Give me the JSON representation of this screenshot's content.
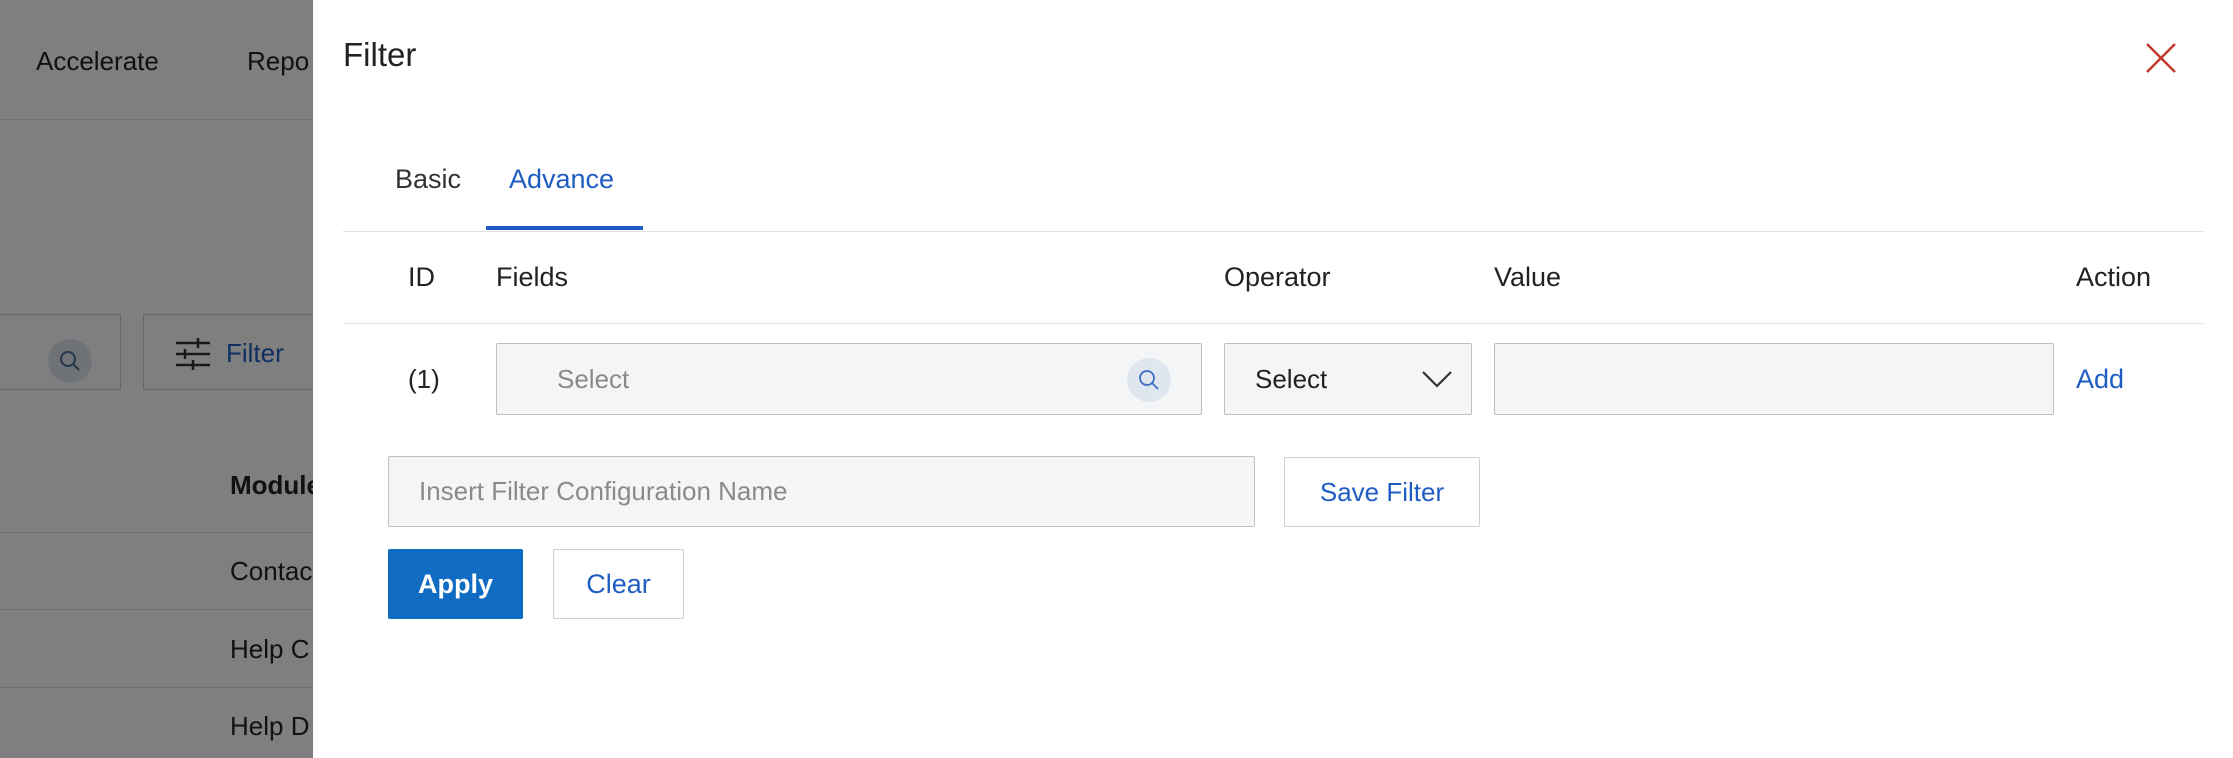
{
  "background": {
    "nav_items": [
      "Accelerate",
      "Repo"
    ],
    "filter_button_label": "Filter",
    "table_header": "Module",
    "rows": [
      "Contac",
      "Help C",
      "Help D"
    ]
  },
  "drawer": {
    "title": "Filter",
    "tabs": [
      {
        "label": "Basic",
        "active": false
      },
      {
        "label": "Advance",
        "active": true
      }
    ],
    "columns": {
      "id": "ID",
      "fields": "Fields",
      "operator": "Operator",
      "value": "Value",
      "action": "Action"
    },
    "rows": [
      {
        "id": "(1)",
        "field_placeholder": "Select",
        "operator_value": "Select",
        "value": "",
        "action_label": "Add"
      }
    ],
    "config_name_placeholder": "Insert Filter Configuration Name",
    "save_filter_label": "Save Filter",
    "apply_label": "Apply",
    "clear_label": "Clear"
  },
  "colors": {
    "accent": "#1f5dc2",
    "primary_button": "#0f6cc2",
    "close_icon": "#c0392b",
    "overlay": "rgba(0,0,0,0.5)"
  }
}
